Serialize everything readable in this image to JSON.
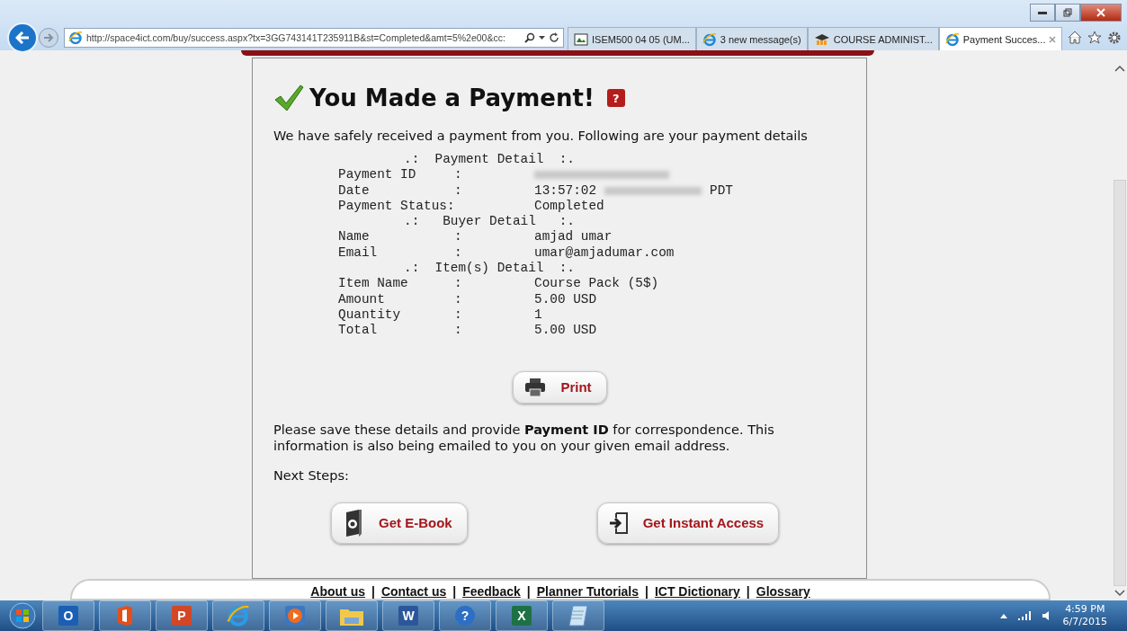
{
  "browser": {
    "address": "http://space4ict.com/buy/success.aspx?tx=3GG743141T235911B&st=Completed&amt=5%2e00&cc:",
    "tabs": [
      {
        "label": "ISEM500 04 05 (UM...",
        "kind": "doc",
        "selected": false
      },
      {
        "label": "3 new message(s)",
        "kind": "ie",
        "selected": false
      },
      {
        "label": "COURSE ADMINIST...",
        "kind": "moodle",
        "selected": false
      },
      {
        "label": "Payment Succes...",
        "kind": "ie",
        "selected": true
      }
    ]
  },
  "page": {
    "heading": "You Made a Payment!",
    "help_badge": "?",
    "intro": "We have safely received a payment from you. Following are your payment details",
    "sections": [
      {
        "title": ".:  Payment Detail  :.",
        "rows": [
          {
            "label": "Payment ID",
            "separator": ":",
            "parts": [
              {
                "kind": "redacted"
              }
            ]
          },
          {
            "label": "Date",
            "separator": ":",
            "parts": [
              {
                "kind": "text",
                "text": "13:57:02"
              },
              {
                "kind": "redacted"
              },
              {
                "kind": "text",
                "text": "PDT"
              }
            ]
          },
          {
            "label": "Payment Status:",
            "parts": [
              {
                "kind": "text",
                "text": "Completed"
              }
            ]
          }
        ]
      },
      {
        "title": ".:   Buyer Detail   :.",
        "rows": [
          {
            "label": "Name",
            "separator": ":",
            "parts": [
              {
                "kind": "text",
                "text": "amjad umar"
              }
            ]
          },
          {
            "label": "Email",
            "separator": ":",
            "parts": [
              {
                "kind": "text",
                "text": "umar@amjadumar.com"
              }
            ]
          }
        ]
      },
      {
        "title": ".:  Item(s) Detail  :.",
        "rows": [
          {
            "label": "Item Name",
            "separator": ":",
            "parts": [
              {
                "kind": "text",
                "text": "Course Pack (5$)"
              }
            ]
          },
          {
            "label": "Amount",
            "separator": ":",
            "parts": [
              {
                "kind": "text",
                "text": "5.00 USD"
              }
            ]
          },
          {
            "label": "Quantity",
            "separator": ":",
            "parts": [
              {
                "kind": "text",
                "text": "1"
              }
            ]
          },
          {
            "label": "Total",
            "separator": ":",
            "parts": [
              {
                "kind": "text",
                "text": "5.00 USD"
              }
            ]
          }
        ]
      }
    ],
    "print_button": "Print",
    "note": "Please save these details and provide **Payment ID** for correspondence. This information is also being emailed to you on your given email address.",
    "next_steps_label": "Next Steps:",
    "next_steps": [
      {
        "label": "Get E-Book",
        "kind": "ebook"
      },
      {
        "label": "Get Instant Access",
        "kind": "access"
      }
    ],
    "footer": {
      "separator": "|",
      "links": [
        "About us",
        "Contact us",
        "Feedback",
        "Planner Tutorials",
        "ICT Dictionary",
        "Glossary"
      ]
    }
  },
  "taskbar": {
    "apps": [
      {
        "kind": "outlook",
        "glyph": "O"
      },
      {
        "kind": "office"
      },
      {
        "kind": "powerpoint",
        "glyph": "P"
      },
      {
        "kind": "ie"
      },
      {
        "kind": "media"
      },
      {
        "kind": "folder"
      },
      {
        "kind": "word",
        "glyph": "W"
      },
      {
        "kind": "help",
        "glyph": "?"
      },
      {
        "kind": "excel",
        "glyph": "X"
      },
      {
        "kind": "notepad"
      }
    ],
    "time": "4:59 PM",
    "date": "6/7/2015"
  }
}
